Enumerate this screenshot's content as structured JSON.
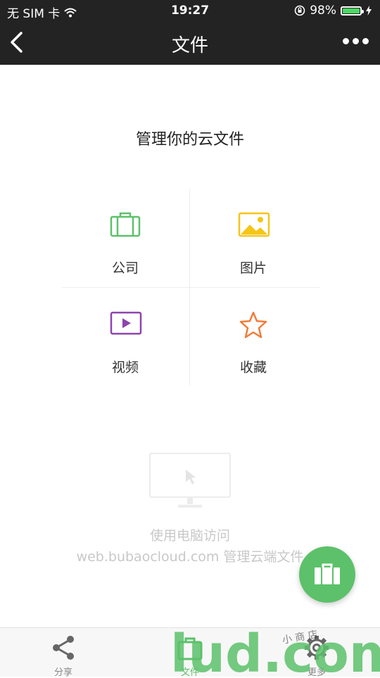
{
  "status_bar": {
    "carrier": "无 SIM 卡",
    "time": "19:27",
    "battery_percent": "98%",
    "battery_level": 0.98
  },
  "nav": {
    "title": "文件"
  },
  "main": {
    "heading": "管理你的云文件",
    "categories": [
      {
        "label": "公司",
        "icon": "briefcase-icon",
        "color": "#5cc16a"
      },
      {
        "label": "图片",
        "icon": "image-icon",
        "color": "#f5c518"
      },
      {
        "label": "视频",
        "icon": "video-icon",
        "color": "#8e44ad"
      },
      {
        "label": "收藏",
        "icon": "star-icon",
        "color": "#f07c3a"
      }
    ]
  },
  "promo": {
    "line1": "使用电脑访问",
    "line2": "web.bubaocloud.com 管理云端文件"
  },
  "tabs": [
    {
      "label": "分享",
      "icon": "share-icon"
    },
    {
      "label": "文件",
      "icon": "briefcase-icon"
    },
    {
      "label": "更多",
      "icon": "gear-icon"
    }
  ],
  "watermark": {
    "text": "lud.com",
    "small_text": "小 商 店"
  },
  "colors": {
    "accent": "#5cc16a",
    "nav_bg": "#232323"
  }
}
